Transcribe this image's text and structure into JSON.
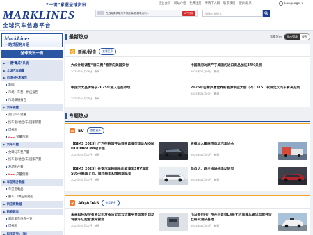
{
  "topbar": {
    "tagline": "“一键”掌握全球资讯",
    "links": [
      "企业会员",
      "网站介绍",
      "免费注册",
      "申请下入网",
      "联系我们",
      "搜索/联系"
    ],
    "language": "Language"
  },
  "header": {
    "logo": "MARKLINES",
    "logo_sub": "全球汽车信息平台",
    "ad_text": "在线免费获取汽车供应商/规模电池汽...",
    "ad_button": "A户订阅",
    "search_placeholder": "请输入关键字"
  },
  "sidebar": {
    "promo_title": "MarkLines",
    "promo_sub": "一站式服务介绍",
    "title": "全球资讯一览",
    "items": [
      {
        "label": "一键“集成”系统",
        "type": "head"
      },
      {
        "label": "全球汽车销量",
        "type": "head"
      },
      {
        "label": "市场+技术报告",
        "type": "head"
      },
      {
        "label": "新闻",
        "type": "sub"
      },
      {
        "label": "市场、车型、供应报告",
        "type": "sub"
      },
      {
        "label": "市场调研报告",
        "type": "sub"
      },
      {
        "label": "汽车销量",
        "type": "head"
      },
      {
        "label": "热门汽车销量",
        "type": "sub"
      },
      {
        "label": "按车型/地区/车/国家销量",
        "type": "sub"
      },
      {
        "label": "可视图",
        "type": "sub"
      },
      {
        "label": "销量预测",
        "type": "sub",
        "new": "New"
      },
      {
        "label": "汽车产量",
        "type": "head"
      },
      {
        "label": "全球分车型产量",
        "type": "sub"
      },
      {
        "label": "按车型/地区/车/国家产量",
        "type": "sub"
      },
      {
        "label": "发动机产量",
        "type": "sub"
      },
      {
        "label": "产量预测",
        "type": "sub",
        "new": "New"
      },
      {
        "label": "车型细分数据",
        "type": "head"
      },
      {
        "label": "车型搭载品",
        "type": "sub"
      },
      {
        "label": "整车厂/供应商搭配",
        "type": "sub"
      },
      {
        "label": "供应商数据",
        "type": "head"
      },
      {
        "label": "新能源车",
        "type": "head"
      },
      {
        "label": "新能源车供应一览",
        "type": "sub"
      },
      {
        "label": "可视图",
        "type": "sub"
      },
      {
        "label": "科技研究+分析",
        "type": "head"
      }
    ]
  },
  "main": {
    "hot_title": "最新热点",
    "switch_label": "切换显示",
    "switch_on": "显示列表",
    "switch_off": "视图",
    "news_card": {
      "title": "新闻/报告",
      "more": "查看更多",
      "items": [
        {
          "title": "大众计划调整“滴口费”暂停向美国交付",
          "date": "2025年04月08日",
          "tag": "新闻"
        },
        {
          "title": "中国政府对原产于美国的进口商品加征34%关税",
          "date": "2025年04月08日",
          "tag": "新闻"
        },
        {
          "title": "中国六大品牌将于2025年进入巴西市场",
          "date": "2025年04月08日",
          "tag": "新闻"
        },
        {
          "title": "2025年巴黎罗曼世界新能源供应大会（2）：ITS、软件定义汽车解决方案",
          "date": "2025年04月07日",
          "tag": "新闻"
        }
      ]
    },
    "topic_title": "专题热点",
    "ev_card": {
      "title": "EV",
      "more": "查看更多",
      "items": [
        {
          "title": "【BIMS 2025】广汽在韩国开始预售紧凑型电动AION UTRIMPV M8冠军版",
          "date": "2025年04月07日",
          "tag": "新闻"
        },
        {
          "title": "板载加入重商用电动汽车协会",
          "date": "2025年04月07日",
          "tag": "新闻"
        },
        {
          "title": "【BIMS 2025】长安汽车韩国推出紧凑型SUV深蓝S05在韩国上市。推出纯电和增程版车型",
          "date": "2025年04月07日",
          "tag": "新闻"
        },
        {
          "title": "马自达：逐步推进纯电动转型",
          "date": "2025年04月07日",
          "tag": "新闻"
        }
      ]
    },
    "adas_card": {
      "title": "AD/ADAS",
      "more": "查看更多",
      "items": [
        {
          "title": "未来科技股份有限公司发布与全球云计算平台运营的自动驾驶车队配套激光雷达",
          "date": "2025年04月07日",
          "tag": "新闻"
        },
        {
          "title": "小马智行在广州开启首批L4级无人驾驶车辆试运营并设立研究测试基地",
          "date": "2025年04月07日",
          "tag": "新闻"
        }
      ]
    }
  },
  "colors": {
    "brand": "#1b3d8f",
    "accent": "#2a56a4",
    "card_border": "#f2a623",
    "new_badge": "#d62c2c"
  }
}
